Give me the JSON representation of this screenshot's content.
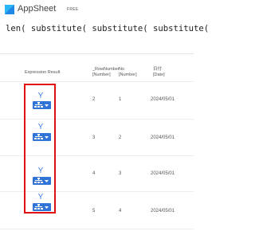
{
  "header": {
    "app_name": "AppSheet",
    "badge": "FREE",
    "logo_icon": "appsheet-logo-icon"
  },
  "formula": "len( substitute( substitute( substitute(",
  "table": {
    "columns": [
      {
        "label": "Expression Result"
      },
      {
        "label": "_RowNumber\n[Number]"
      },
      {
        "label": "No\n[Number]"
      },
      {
        "label": "日付\n[Date]"
      }
    ],
    "rows": [
      {
        "result": "Y",
        "row_number": "2",
        "no": "1",
        "date": "2024/05/01"
      },
      {
        "result": "Y",
        "row_number": "3",
        "no": "2",
        "date": "2024/05/01"
      },
      {
        "result": "Y",
        "row_number": "4",
        "no": "3",
        "date": "2024/05/01"
      },
      {
        "result": "Y",
        "row_number": "5",
        "no": "4",
        "date": "2024/05/01"
      }
    ]
  },
  "colors": {
    "accent": "#2f74d6",
    "result_text": "#3b7de0",
    "highlight": "#e01010"
  }
}
